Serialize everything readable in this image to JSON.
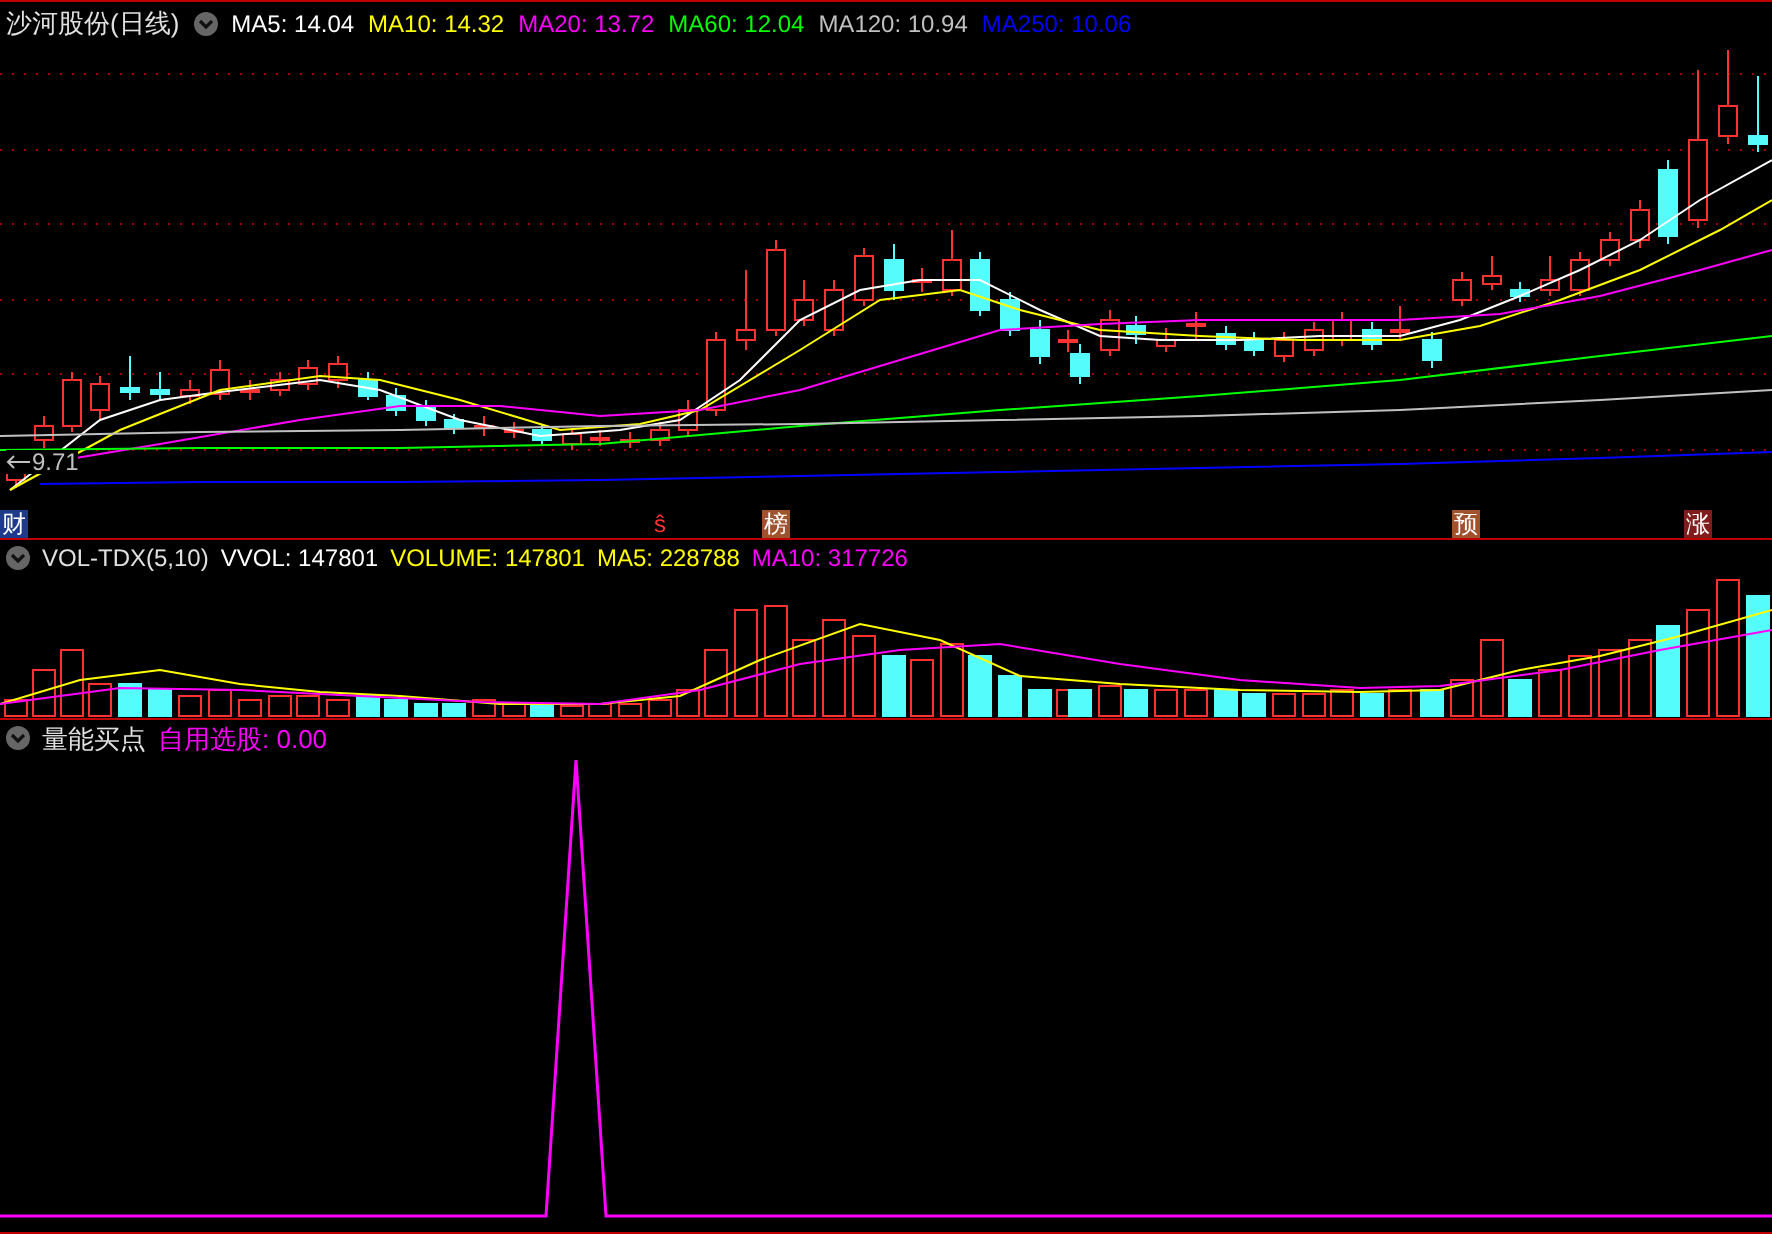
{
  "main_pane": {
    "title": "沙河股份(日线)",
    "indicators": [
      {
        "label": "MA5: 14.04",
        "color": "#ffffff"
      },
      {
        "label": "MA10: 14.32",
        "color": "#ffff00"
      },
      {
        "label": "MA20: 13.72",
        "color": "#ff00ff"
      },
      {
        "label": "MA60: 12.04",
        "color": "#00ff00"
      },
      {
        "label": "MA120: 10.94",
        "color": "#c0c0c0"
      },
      {
        "label": "MA250: 10.06",
        "color": "#0000ff"
      }
    ],
    "price_marker": "9.71",
    "event_markers": [
      {
        "label": "财",
        "color": "#1e3a8a"
      },
      {
        "label": "ŝ",
        "color": "#000000"
      },
      {
        "label": "榜",
        "color": "#a0522d"
      },
      {
        "label": "预",
        "color": "#a0522d"
      },
      {
        "label": "涨",
        "color": "#7f1d1d"
      }
    ]
  },
  "volume_pane": {
    "title": "VOL-TDX(5,10)",
    "indicators": [
      {
        "label": "VVOL: 147801",
        "color": "#ffffff"
      },
      {
        "label": "VOLUME: 147801",
        "color": "#ffff00"
      },
      {
        "label": "MA5: 228788",
        "color": "#ffff00"
      },
      {
        "label": "MA10: 317726",
        "color": "#ff00ff"
      }
    ]
  },
  "signal_pane": {
    "title": "量能买点",
    "indicators": [
      {
        "label": "自用选股: 0.00",
        "color": "#ff00ff"
      }
    ]
  }
}
